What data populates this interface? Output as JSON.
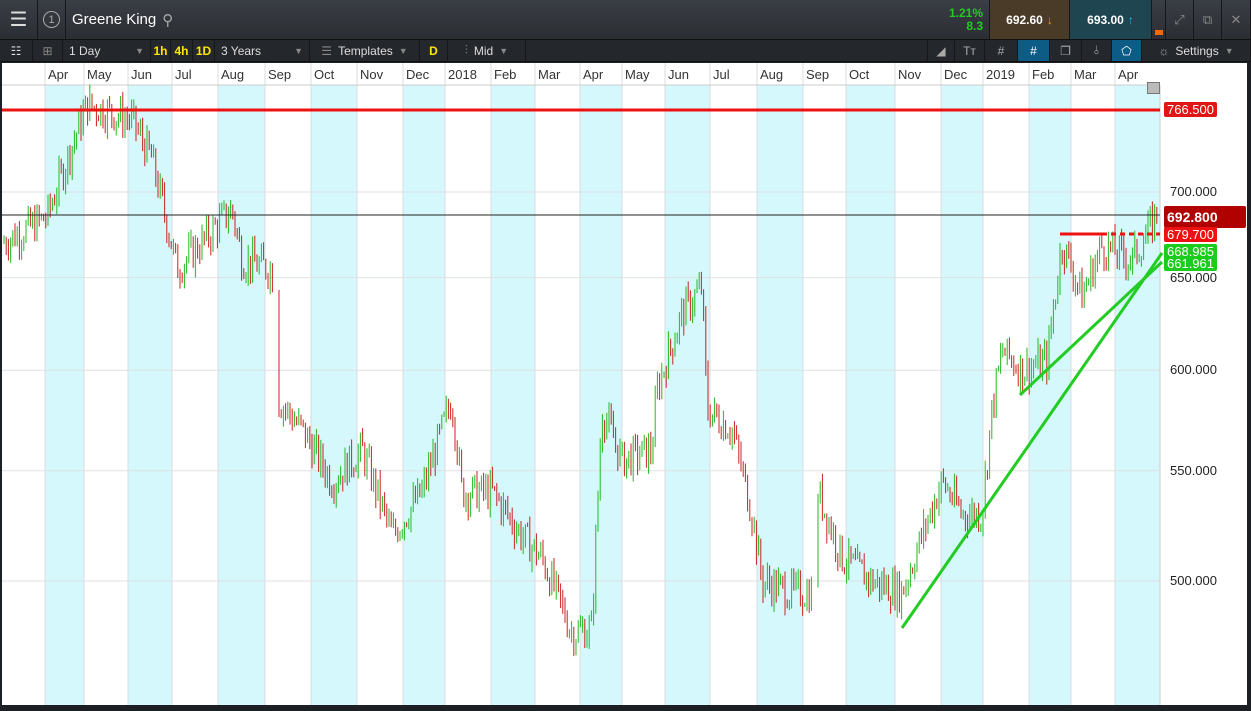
{
  "header": {
    "title": "Greene King",
    "badge": "1",
    "change_pct": "1.21%",
    "change_abs": "8.3",
    "sell": "692.60",
    "buy": "693.00"
  },
  "toolbar": {
    "interval": "1 Day",
    "q1": "1h",
    "q2": "4h",
    "q3": "1D",
    "range": "3 Years",
    "templates": "Templates",
    "d": "D",
    "price_type": "Mid",
    "settings": "Settings"
  },
  "months": [
    "Apr",
    "May",
    "Jun",
    "Jul",
    "Aug",
    "Sep",
    "Oct",
    "Nov",
    "Dec",
    "2018",
    "Feb",
    "Mar",
    "Apr",
    "May",
    "Jun",
    "Jul",
    "Aug",
    "Sep",
    "Oct",
    "Nov",
    "Dec",
    "2019",
    "Feb",
    "Mar",
    "Apr"
  ],
  "y_axis": [
    "700.000",
    "650.000",
    "600.000",
    "550.000",
    "500.000"
  ],
  "levels": {
    "resistance": "766.500",
    "current": "692.800",
    "recent_high": "679.700",
    "trend1": "668.985",
    "trend2": "661.961"
  },
  "colors": {
    "up": "#22bb22",
    "down": "#cc2222",
    "band": "#d4f8fb",
    "red": "#ee1111",
    "green": "#22cc22"
  },
  "price_path": [
    [
      0,
      670
    ],
    [
      45,
      685
    ],
    [
      85,
      755
    ],
    [
      130,
      745
    ],
    [
      150,
      720
    ],
    [
      175,
      655
    ],
    [
      200,
      670
    ],
    [
      230,
      690
    ],
    [
      240,
      660
    ],
    [
      270,
      655
    ],
    [
      276,
      585
    ],
    [
      300,
      570
    ],
    [
      330,
      545
    ],
    [
      360,
      560
    ],
    [
      390,
      520
    ],
    [
      420,
      540
    ],
    [
      450,
      585
    ],
    [
      460,
      540
    ],
    [
      490,
      540
    ],
    [
      520,
      520
    ],
    [
      540,
      510
    ],
    [
      570,
      478
    ],
    [
      590,
      480
    ],
    [
      600,
      580
    ],
    [
      620,
      555
    ],
    [
      650,
      560
    ],
    [
      655,
      590
    ],
    [
      680,
      630
    ],
    [
      700,
      645
    ],
    [
      705,
      580
    ],
    [
      730,
      570
    ],
    [
      750,
      530
    ],
    [
      760,
      500
    ],
    [
      790,
      495
    ],
    [
      810,
      495
    ],
    [
      816,
      540
    ],
    [
      840,
      510
    ],
    [
      870,
      500
    ],
    [
      900,
      495
    ],
    [
      940,
      545
    ],
    [
      960,
      530
    ],
    [
      980,
      530
    ],
    [
      990,
      580
    ],
    [
      1000,
      610
    ],
    [
      1020,
      600
    ],
    [
      1045,
      605
    ],
    [
      1060,
      670
    ],
    [
      1080,
      640
    ],
    [
      1100,
      668
    ],
    [
      1130,
      660
    ],
    [
      1150,
      680
    ],
    [
      1156,
      692
    ]
  ]
}
